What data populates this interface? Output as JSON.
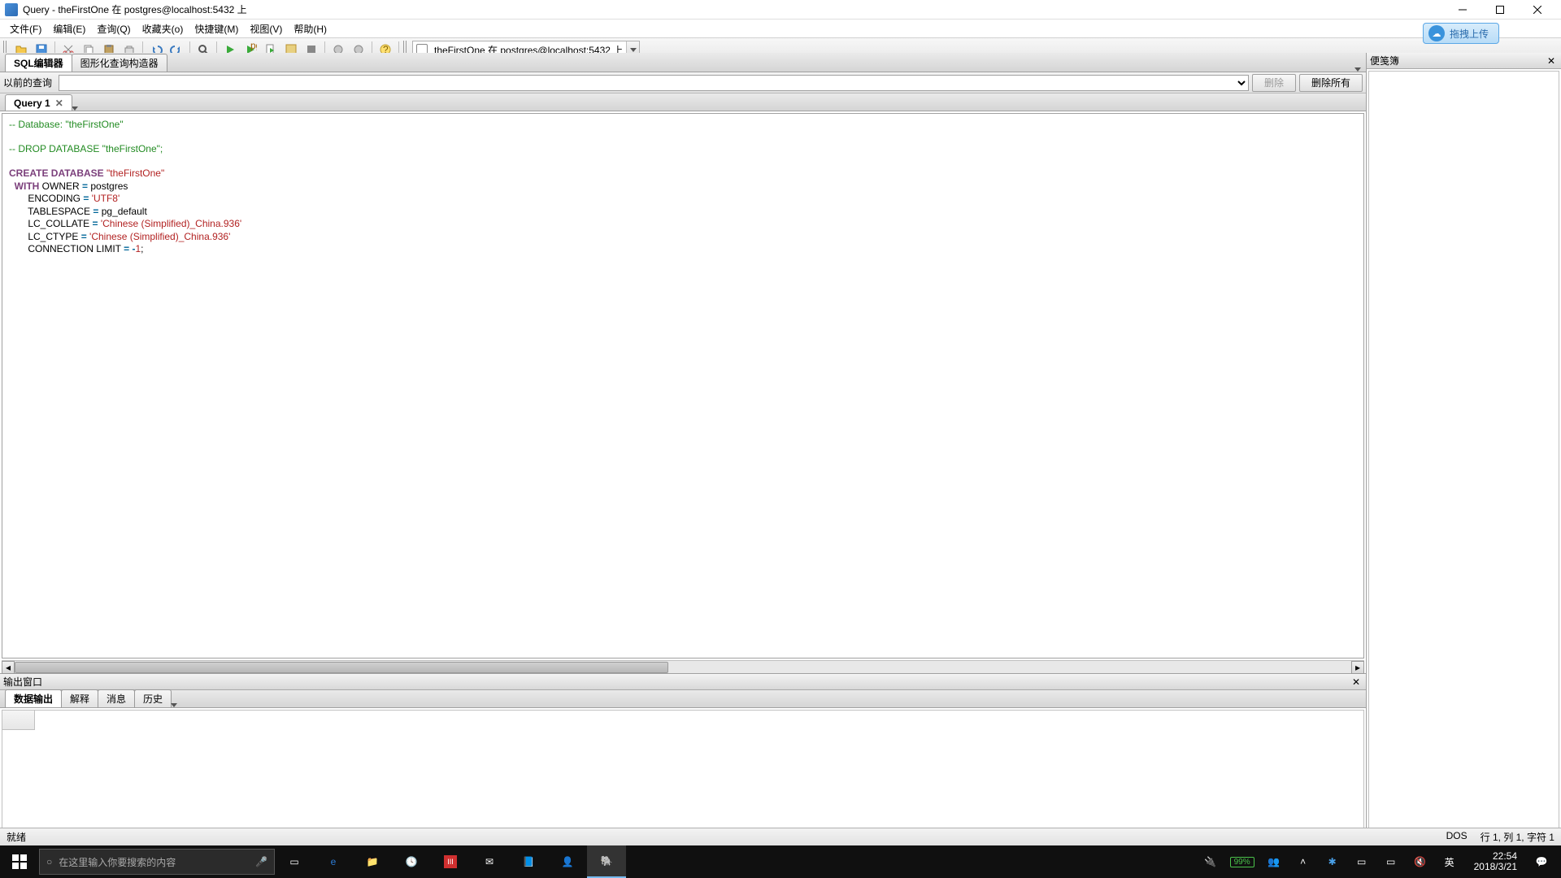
{
  "window": {
    "title": "Query - theFirstOne 在  postgres@localhost:5432 上"
  },
  "menu": {
    "file": "文件(F)",
    "edit": "编辑(E)",
    "query": "查询(Q)",
    "favorites": "收藏夹(o)",
    "macros": "快捷键(M)",
    "view": "视图(V)",
    "help": "帮助(H)"
  },
  "upload_btn": "拖拽上传",
  "connection": {
    "label": "theFirstOne 在  postgres@localhost:5432 上"
  },
  "top_tabs": {
    "sql_editor": "SQL编辑器",
    "graphical": "图形化查询构造器"
  },
  "prev_query": {
    "label": "以前的查询",
    "delete": "删除",
    "delete_all": "删除所有"
  },
  "query_tab": "Query 1",
  "sql": {
    "l1_a": "-- Database: ",
    "l1_b": "\"theFirstOne\"",
    "l3": "-- DROP DATABASE \"theFirstOne\";",
    "l5_a": "CREATE DATABASE",
    "l5_b": " \"theFirstOne\"",
    "l6_a": "  WITH",
    "l6_b": " OWNER ",
    "l6_c": "=",
    "l6_d": " postgres",
    "l7_a": "       ENCODING ",
    "l7_b": "=",
    "l7_c": " 'UTF8'",
    "l8_a": "       TABLESPACE ",
    "l8_b": "=",
    "l8_c": " pg_default",
    "l9_a": "       LC_COLLATE ",
    "l9_b": "=",
    "l9_c": " 'Chinese (Simplified)_China.936'",
    "l10_a": "       LC_CTYPE ",
    "l10_b": "=",
    "l10_c": " 'Chinese (Simplified)_China.936'",
    "l11_a": "       CONNECTION LIMIT ",
    "l11_b": "=",
    "l11_c": " -",
    "l11_d": "1",
    "l11_e": ";"
  },
  "scratchpad": {
    "title": "便笺簿"
  },
  "output": {
    "title": "输出窗口",
    "tab_data": "数据输出",
    "tab_explain": "解释",
    "tab_message": "消息",
    "tab_history": "历史"
  },
  "status": {
    "ready": "就绪",
    "mode": "DOS",
    "pos": "行 1, 列 1, 字符 1"
  },
  "taskbar": {
    "search_placeholder": "在这里输入你要搜索的内容",
    "battery": "99%",
    "ime": "英",
    "time": "22:54",
    "date": "2018/3/21"
  }
}
